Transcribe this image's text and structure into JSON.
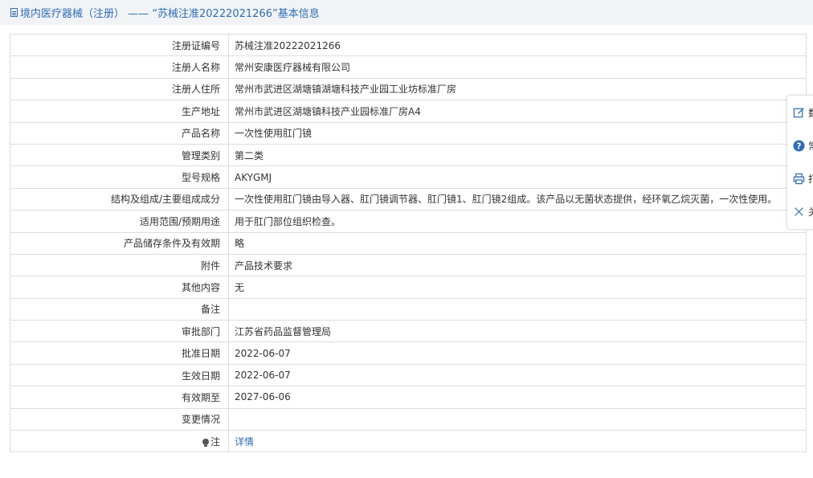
{
  "header": {
    "title": "境内医疗器械（注册） ——  “苏械注准20222021266”基本信息"
  },
  "rows": [
    {
      "label": "注册证编号",
      "value": "苏械注准20222021266"
    },
    {
      "label": "注册人名称",
      "value": "常州安康医疗器械有限公司"
    },
    {
      "label": "注册人住所",
      "value": "常州市武进区湖塘镇湖塘科技产业园工业坊标准厂房"
    },
    {
      "label": "生产地址",
      "value": "常州市武进区湖塘镇科技产业园标准厂房A4"
    },
    {
      "label": "产品名称",
      "value": "一次性使用肛门镜"
    },
    {
      "label": "管理类别",
      "value": "第二类"
    },
    {
      "label": "型号规格",
      "value": "AKYGMJ"
    },
    {
      "label": "结构及组成/主要组成成分",
      "value": "一次性使用肛门镜由导入器、肛门镜调节器、肛门镜1、肛门镜2组成。该产品以无菌状态提供，经环氧乙烷灭菌，一次性使用。"
    },
    {
      "label": "适用范围/预期用途",
      "value": "用于肛门部位组织检查。"
    },
    {
      "label": "产品储存条件及有效期",
      "value": "略"
    },
    {
      "label": "附件",
      "value": "产品技术要求"
    },
    {
      "label": "其他内容",
      "value": "无"
    },
    {
      "label": "备注",
      "value": ""
    },
    {
      "label": "审批部门",
      "value": "江苏省药品监督管理局"
    },
    {
      "label": "批准日期",
      "value": "2022-06-07"
    },
    {
      "label": "生效日期",
      "value": "2022-06-07"
    },
    {
      "label": "有效期至",
      "value": "2027-06-06"
    },
    {
      "label": "变更情况",
      "value": ""
    }
  ],
  "note_row": {
    "label": "注",
    "link": "详情"
  },
  "side_toolbar": {
    "items": [
      {
        "icon": "edit-icon",
        "label": "数"
      },
      {
        "icon": "help-icon",
        "label": "常"
      },
      {
        "icon": "print-icon",
        "label": "打"
      },
      {
        "icon": "close-icon",
        "label": "关"
      }
    ]
  },
  "colors": {
    "accent": "#2e6db4",
    "border": "#dddddd",
    "header_bg": "#f1f3f6"
  }
}
